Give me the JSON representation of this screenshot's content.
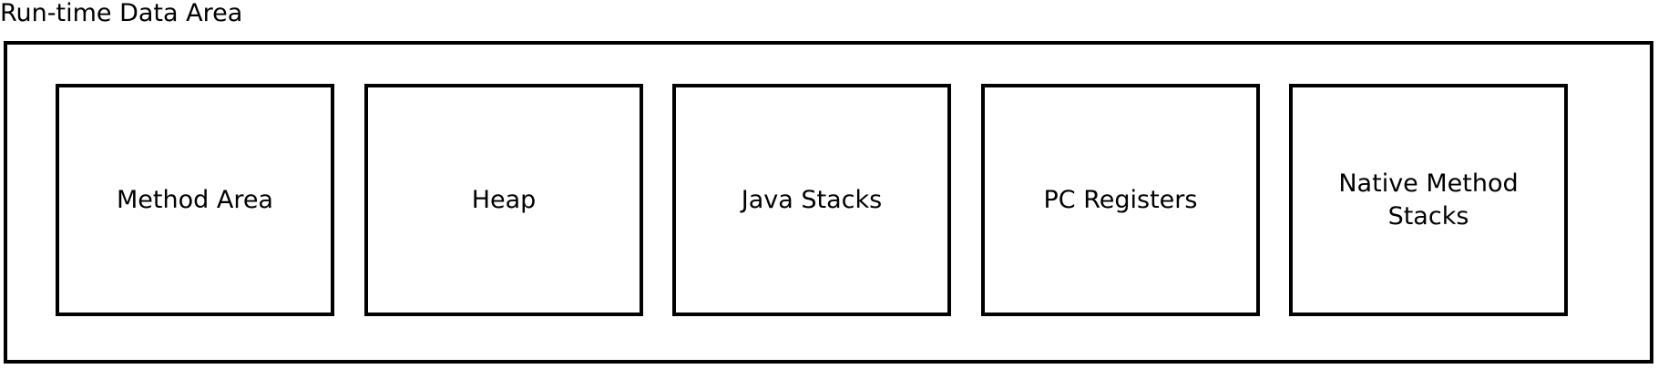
{
  "diagram": {
    "title": "Run-time Data Area",
    "areas": [
      {
        "label": "Method Area"
      },
      {
        "label": "Heap"
      },
      {
        "label": "Java Stacks"
      },
      {
        "label": "PC Registers"
      },
      {
        "label": "Native Method Stacks"
      }
    ]
  }
}
